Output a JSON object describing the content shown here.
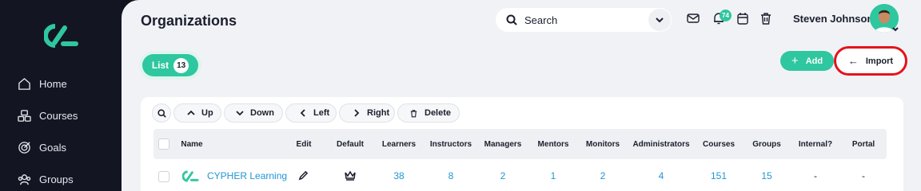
{
  "app": {
    "page_title": "Organizations"
  },
  "sidebar": {
    "items": [
      {
        "label": "Home",
        "icon": "home-icon"
      },
      {
        "label": "Courses",
        "icon": "courses-icon"
      },
      {
        "label": "Goals",
        "icon": "goals-icon"
      },
      {
        "label": "Groups",
        "icon": "groups-icon"
      }
    ]
  },
  "header": {
    "search_label": "Search",
    "notification_count": "74",
    "user_name": "Steven Johnson"
  },
  "tabs": {
    "list_label": "List",
    "list_count": "13"
  },
  "actions": {
    "add_label": "Add",
    "import_label": "Import"
  },
  "toolbar": {
    "up": "Up",
    "down": "Down",
    "left": "Left",
    "right": "Right",
    "delete": "Delete"
  },
  "table": {
    "columns": [
      "Name",
      "Edit",
      "Default",
      "Learners",
      "Instructors",
      "Managers",
      "Mentors",
      "Monitors",
      "Administrators",
      "Courses",
      "Groups",
      "Internal?",
      "Portal"
    ],
    "rows": [
      {
        "name": "CYPHER Learning",
        "learners": "38",
        "instructors": "8",
        "managers": "2",
        "mentors": "1",
        "monitors": "2",
        "administrators": "4",
        "courses": "151",
        "groups": "15",
        "internal": "-",
        "portal": "-"
      }
    ]
  },
  "colors": {
    "accent": "#2fc79f",
    "sidebar": "#131622",
    "link": "#2196d3",
    "highlight": "#e3131b"
  }
}
